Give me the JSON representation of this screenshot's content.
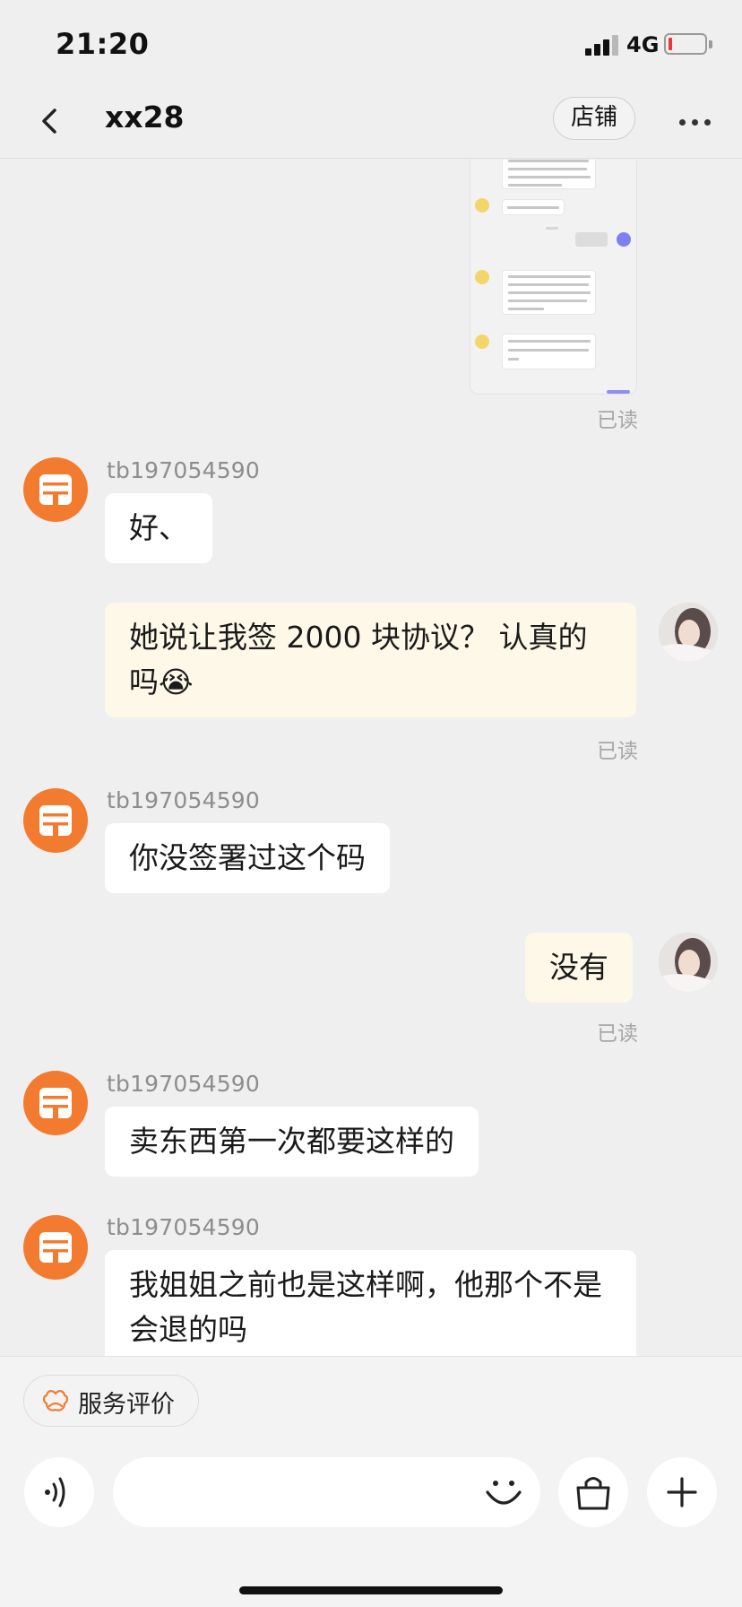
{
  "status_bar": {
    "time": "21:20",
    "network": "4G"
  },
  "nav": {
    "title": "xx28",
    "shop_button": "店铺"
  },
  "colors": {
    "accent": "#f37b2f",
    "my_bubble": "#fdf8e8",
    "other_bubble": "#ffffff",
    "background": "#efefef"
  },
  "messages": [
    {
      "sender": "me",
      "type": "image",
      "read_status": "已读"
    },
    {
      "sender": "tb197054590",
      "text": "好、"
    },
    {
      "sender": "me",
      "text": "她说让我签 2000 块协议？ 认真的吗😭",
      "read_status": "已读"
    },
    {
      "sender": "tb197054590",
      "text": "你没签署过这个码"
    },
    {
      "sender": "me",
      "text": "没有",
      "read_status": "已读"
    },
    {
      "sender": "tb197054590",
      "text": "卖东西第一次都要这样的"
    },
    {
      "sender": "tb197054590",
      "text": "我姐姐之前也是这样啊，他那个不是会退的吗"
    }
  ],
  "bottom": {
    "service_eval_label": "服务评价",
    "input_placeholder": "",
    "icons": [
      "voice-icon",
      "emoji-icon",
      "shopping-bag-icon",
      "plus-icon"
    ]
  }
}
